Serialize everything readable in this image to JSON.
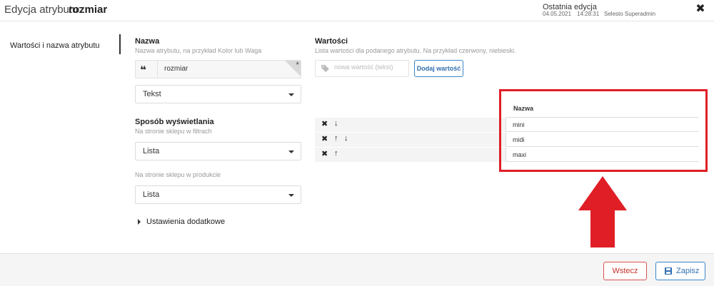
{
  "header": {
    "title_prefix": "Edycja atrybutu:",
    "title_name": "rozmiar",
    "last_edit_label": "Ostatnia edycja",
    "last_edit_date": "04.05.2021",
    "last_edit_time": "14:28:31",
    "last_edit_user": "Selesto Superadmin",
    "close_icon": "close-icon"
  },
  "sidebar": {
    "tab_label": "Wartości i nazwa atrybutu"
  },
  "name_section": {
    "title": "Nazwa",
    "subtitle": "Nazwa atrybutu, na przykład Kolor lub Waga",
    "quote_glyph": "❝",
    "value": "rozmiar",
    "required_glyph": "*",
    "type_select": "Tekst"
  },
  "display_section": {
    "title": "Sposób wyświetlania",
    "filters_label": "Na stronie sklepu w filtrach",
    "filters_select": "Lista",
    "product_label": "Na stronie sklepu w produkcie",
    "product_select": "Lista"
  },
  "values_section": {
    "title": "Wartości",
    "subtitle": "Lista wartości dla podanego atrybutu. Na przykład czerwony, niebieski.",
    "input_placeholder": "nowa wartość (tekst)",
    "add_button": "Dodaj wartość",
    "table_header": "Nazwa",
    "rows": [
      {
        "value": "mini",
        "delete": "✖",
        "up": "",
        "down": "↓"
      },
      {
        "value": "midi",
        "delete": "✖",
        "up": "↑",
        "down": "↓"
      },
      {
        "value": "maxi",
        "delete": "✖",
        "up": "↑",
        "down": ""
      }
    ]
  },
  "advanced": {
    "label": "Ustawienia dodatkowe"
  },
  "footer": {
    "back_button": "Wstecz",
    "save_button": "Zapisz"
  },
  "colors": {
    "highlight": "#e01e26",
    "primary": "#2f6fb0",
    "danger": "#c9302c"
  }
}
